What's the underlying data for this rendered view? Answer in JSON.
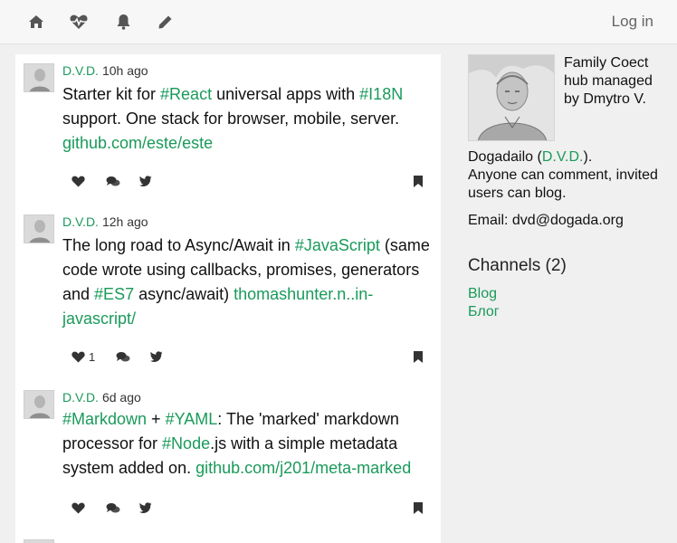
{
  "nav": {
    "icons": [
      "home-icon",
      "heartbeat-icon",
      "bell-icon",
      "pencil-icon"
    ],
    "login_label": "Log in"
  },
  "colors": {
    "link": "#1a9a5a",
    "text": "#111111",
    "muted": "#666666",
    "background": "#f0f0f0"
  },
  "posts": [
    {
      "author": "D.V.D.",
      "time": "10h ago",
      "parts": [
        {
          "t": "Starter kit for "
        },
        {
          "t": "#React",
          "link": true
        },
        {
          "t": " universal apps with "
        },
        {
          "t": "#I18N",
          "link": true
        },
        {
          "t": " support. One stack for browser, mobile, server. "
        },
        {
          "t": "github.com/este/este",
          "link": true
        }
      ],
      "likes": ""
    },
    {
      "author": "D.V.D.",
      "time": "12h ago",
      "parts": [
        {
          "t": "The long road to Async/Await in "
        },
        {
          "t": "#JavaScript",
          "link": true
        },
        {
          "t": " (same code wrote using callbacks, promises, generators and "
        },
        {
          "t": "#ES7",
          "link": true
        },
        {
          "t": " async/await) "
        },
        {
          "t": "thomashunter.n..in-javascript/",
          "link": true
        }
      ],
      "likes": "1"
    },
    {
      "author": "D.V.D.",
      "time": "6d ago",
      "parts": [
        {
          "t": "#Markdown",
          "link": true
        },
        {
          "t": " + "
        },
        {
          "t": "#YAML",
          "link": true
        },
        {
          "t": ": The 'marked' markdown processor for "
        },
        {
          "t": "#Node",
          "link": true
        },
        {
          "t": ".js with a simple metadata system added on. "
        },
        {
          "t": "github.com/j201/meta-marked",
          "link": true
        }
      ],
      "likes": ""
    }
  ],
  "sidebar": {
    "caption": "Family Coect hub managed by Dmytro V.",
    "owner_prefix": "Dogadailo (",
    "owner_link": "D.V.D.",
    "owner_suffix": ").",
    "about_text": "Anyone can comment, invited users can blog.",
    "email": "Email: dvd@dogada.org",
    "channels_title": "Channels (2)",
    "channels": [
      "Blog",
      "Блог"
    ]
  }
}
